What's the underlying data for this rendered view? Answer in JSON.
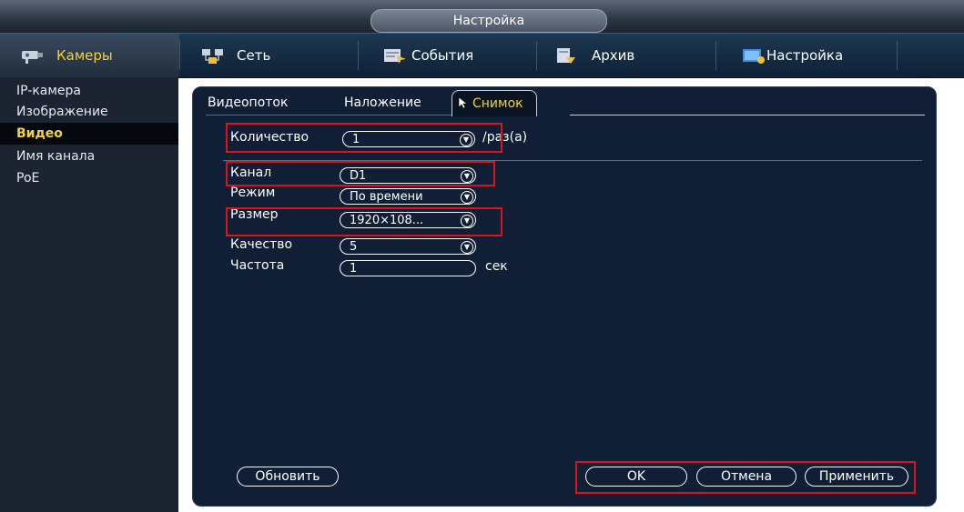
{
  "window": {
    "title": "Настройка"
  },
  "nav": {
    "items": [
      {
        "label": "Камеры",
        "icon": "camera-icon"
      },
      {
        "label": "Сеть",
        "icon": "network-icon"
      },
      {
        "label": "События",
        "icon": "events-icon"
      },
      {
        "label": "Архив",
        "icon": "archive-icon"
      },
      {
        "label": "Настройка",
        "icon": "settings-icon"
      }
    ]
  },
  "sidebar": {
    "items": [
      {
        "label": "IP-камера"
      },
      {
        "label": "Изображение"
      },
      {
        "label": "Видео",
        "active": true
      },
      {
        "label": "Имя канала"
      },
      {
        "label": "PoE"
      }
    ]
  },
  "tabs": [
    {
      "label": "Видеопоток"
    },
    {
      "label": "Наложение"
    },
    {
      "label": "Снимок",
      "active": true
    }
  ],
  "form": {
    "quantity": {
      "label": "Количество",
      "value": "1",
      "unit": "/раз(а)"
    },
    "channel": {
      "label": "Канал",
      "value": "D1"
    },
    "mode": {
      "label": "Режим",
      "value": "По времени"
    },
    "size": {
      "label": "Размер",
      "value": "1920×108..."
    },
    "quality": {
      "label": "Качество",
      "value": "5"
    },
    "frequency": {
      "label": "Частота",
      "value": "1",
      "unit": "сек"
    }
  },
  "buttons": {
    "refresh": "Обновить",
    "ok": "OK",
    "cancel": "Отмена",
    "apply": "Применить"
  },
  "colors": {
    "accent_yellow": "#f1d23e",
    "highlight_red": "#d8141c",
    "panel_bg": "#101f35"
  }
}
